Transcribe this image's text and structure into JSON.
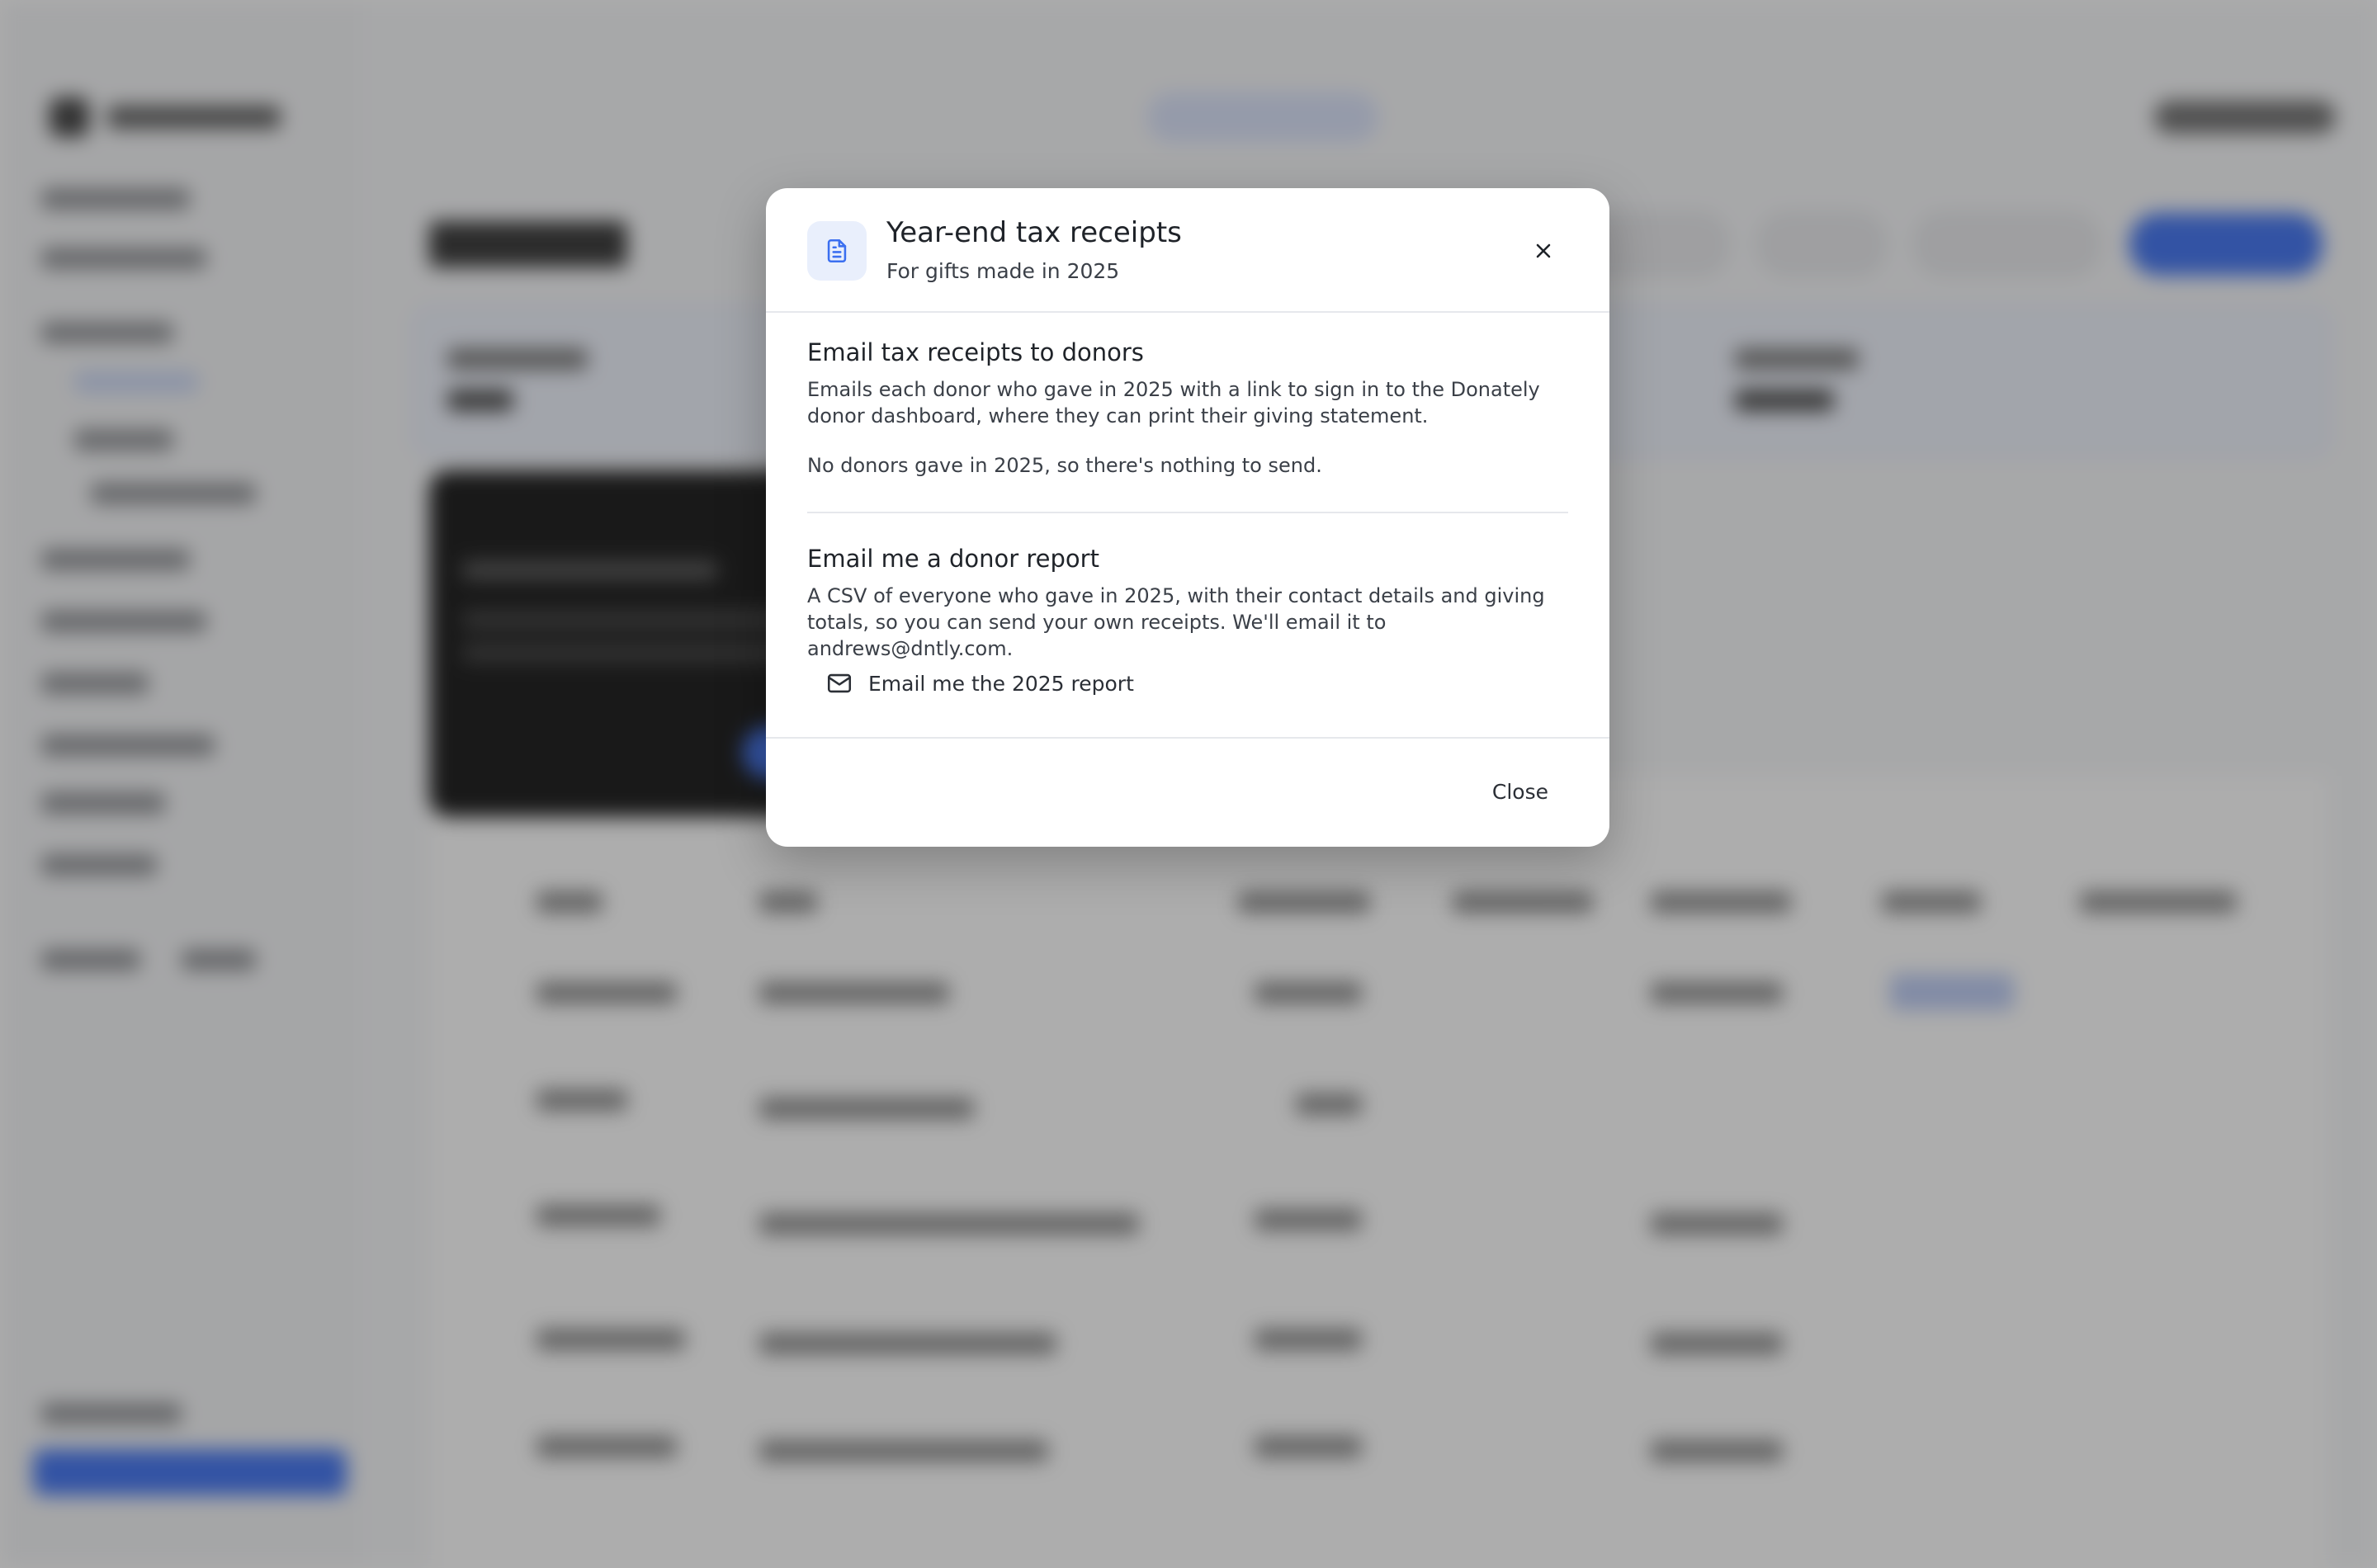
{
  "modal": {
    "title": "Year-end tax receipts",
    "subtitle": "For gifts made in 2025",
    "header_icon": "document-icon",
    "close_icon": "close-icon",
    "sections": {
      "email_donors": {
        "title": "Email tax receipts to donors",
        "description": "Emails each donor who gave in 2025 with a link to sign in to the Donately donor dashboard, where they can print their giving statement.",
        "status": "No donors gave in 2025, so there's nothing to send."
      },
      "donor_report": {
        "title": "Email me a donor report",
        "description": "A CSV of everyone who gave in 2025, with their contact details and giving totals, so you can send your own receipts. We'll email it to andrews@dntly.com.",
        "button_label": "Email me the 2025 report",
        "button_icon": "mail-icon"
      }
    },
    "footer": {
      "close_label": "Close"
    }
  },
  "colors": {
    "accent": "#3b6ff0",
    "icon_bg": "#e9effc",
    "icon_fg": "#3b6ff0",
    "text": "#2b2f36"
  }
}
